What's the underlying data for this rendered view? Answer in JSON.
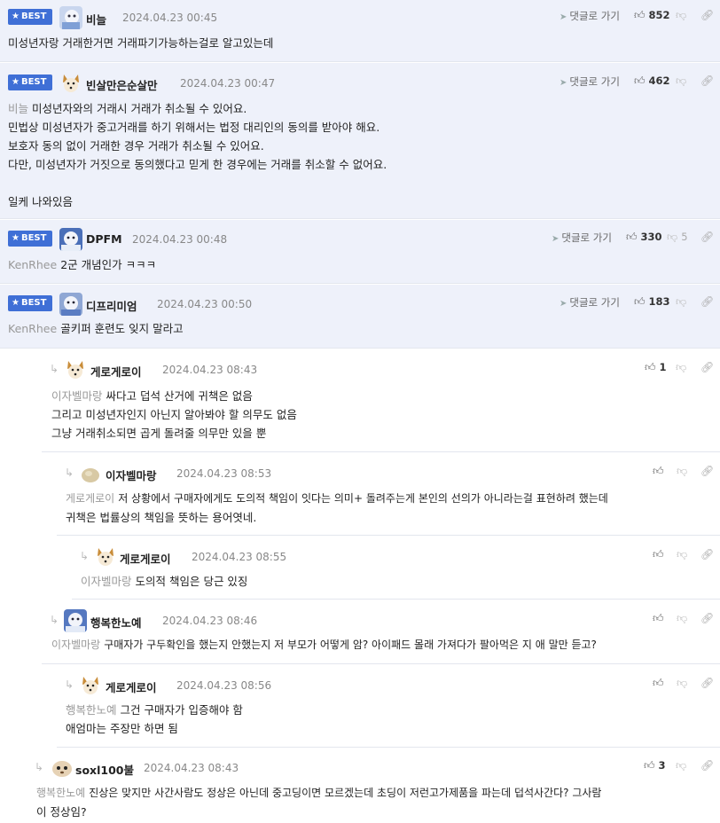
{
  "ui": {
    "best_label": "BEST",
    "goto_reply_label": "댓글로 가기"
  },
  "comments": [
    {
      "best": true,
      "nick": "비늘",
      "date": "2024.04.23 00:45",
      "likes": "852",
      "dislikes": "",
      "mention": "",
      "lines": [
        "미성년자랑 거래한거면 거래파기가능하는걸로 알고있는데"
      ]
    },
    {
      "best": true,
      "nick": "빈살만은순살만",
      "date": "2024.04.23 00:47",
      "likes": "462",
      "dislikes": "",
      "mention": "비늘",
      "lines": [
        "미성년자와의 거래시 거래가 취소될 수 있어요.",
        "민법상 미성년자가 중고거래를 하기 위해서는 법정 대리인의 동의를 받아야 해요.",
        "보호자 동의 없이 거래한 경우 거래가 취소될 수 있어요.",
        "다만, 미성년자가 거짓으로 동의했다고 믿게 한 경우에는 거래를 취소할 수 없어요.",
        "",
        "일케 나와있음"
      ]
    },
    {
      "best": true,
      "nick": "DPFM",
      "date": "2024.04.23 00:48",
      "likes": "330",
      "dislikes": "5",
      "mention": "KenRhee",
      "lines": [
        "2군 개념인가 ㅋㅋㅋ"
      ]
    },
    {
      "best": true,
      "nick": "디프리미엄",
      "date": "2024.04.23 00:50",
      "likes": "183",
      "dislikes": "",
      "mention": "KenRhee",
      "lines": [
        "골키퍼 훈련도 잊지 말라고"
      ]
    },
    {
      "best": false,
      "nick": "게로게로이",
      "date": "2024.04.23 08:43",
      "likes": "1",
      "dislikes": "",
      "mention": "이자벨마랑",
      "lines": [
        "싸다고 덥석 산거에 귀책은 없음",
        "그리고 미성년자인지 아닌지 알아봐야 할 의무도 없음",
        "그냥 거래취소되면 곱게 돌려줄 의무만 있을 뿐"
      ]
    },
    {
      "best": false,
      "nick": "이자벨마랑",
      "date": "2024.04.23 08:53",
      "likes": "",
      "dislikes": "",
      "mention": "게로게로이",
      "lines": [
        "저 상황에서 구매자에게도 도의적 책임이 잇다는 의미+ 돌려주는게 본인의 선의가 아니라는걸 표현하려 했는데",
        "귀책은 법률상의 책임을 뜻하는 용어엿네."
      ]
    },
    {
      "best": false,
      "nick": "게로게로이",
      "date": "2024.04.23 08:55",
      "likes": "",
      "dislikes": "",
      "mention": "이자벨마랑",
      "lines": [
        "도의적 책임은 당근 있징"
      ]
    },
    {
      "best": false,
      "nick": "행복한노예",
      "date": "2024.04.23 08:46",
      "likes": "",
      "dislikes": "",
      "mention": "이자벨마랑",
      "lines": [
        "구매자가 구두확인을 했는지 안했는지 저 부모가 어떻게 암? 아이패드 몰래 가져다가 팔아먹은 지 애 말만 듣고?"
      ]
    },
    {
      "best": false,
      "nick": "게로게로이",
      "date": "2024.04.23 08:56",
      "likes": "",
      "dislikes": "",
      "mention": "행복한노예",
      "lines": [
        "그건 구매자가 입증해야 함",
        "애엄마는 주장만 하면 됨"
      ]
    },
    {
      "best": false,
      "nick": "soxl100불",
      "date": "2024.04.23 08:43",
      "likes": "3",
      "dislikes": "",
      "mention": "행복한노예",
      "lines": [
        "진상은 맞지만 사간사람도 정상은 아닌데 중고딩이면 모르겠는데 초딩이 저런고가제품을 파는데 덥석사간다? 그사람",
        "이 정상임?"
      ]
    }
  ],
  "colors": {
    "best_bg": "#eef1fa",
    "badge": "#3f6fd6",
    "mention": "#999999"
  }
}
